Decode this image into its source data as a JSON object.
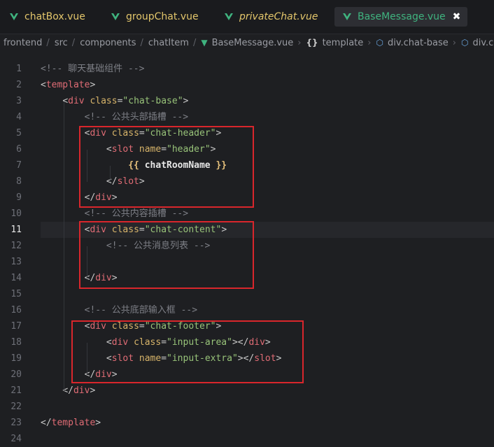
{
  "tabs": [
    {
      "label": "chatBox.vue",
      "icon": "vue-icon",
      "active": false,
      "italic": false
    },
    {
      "label": "groupChat.vue",
      "icon": "vue-icon",
      "active": false,
      "italic": false
    },
    {
      "label": "privateChat.vue",
      "icon": "vue-icon",
      "active": false,
      "italic": true
    },
    {
      "label": "BaseMessage.vue",
      "icon": "vue-icon",
      "active": true,
      "italic": false,
      "close": "✖"
    }
  ],
  "breadcrumb": [
    {
      "label": "frontend"
    },
    {
      "label": "src"
    },
    {
      "label": "components"
    },
    {
      "label": "chatItem"
    },
    {
      "label": "BaseMessage.vue",
      "icon": "vue-icon"
    },
    {
      "label": "template",
      "icon": "braces-icon"
    },
    {
      "label": "div.chat-base",
      "icon": "cube-icon"
    },
    {
      "label": "div.chat-co",
      "icon": "cube-icon"
    }
  ],
  "editor": {
    "current_line": 11,
    "lines": [
      {
        "n": "1",
        "text": "<!-- 聊天基础组件 -->"
      },
      {
        "n": "2",
        "text": "<template>"
      },
      {
        "n": "3",
        "text": "    <div class=\"chat-base\">"
      },
      {
        "n": "4",
        "text": "        <!-- 公共头部插槽 -->"
      },
      {
        "n": "5",
        "text": "        <div class=\"chat-header\">"
      },
      {
        "n": "6",
        "text": "            <slot name=\"header\">"
      },
      {
        "n": "7",
        "text": "                {{ chatRoomName }}"
      },
      {
        "n": "8",
        "text": "            </slot>"
      },
      {
        "n": "9",
        "text": "        </div>"
      },
      {
        "n": "10",
        "text": "        <!-- 公共内容插槽 -->"
      },
      {
        "n": "11",
        "text": "        <div class=\"chat-content\">"
      },
      {
        "n": "12",
        "text": "            <!-- 公共消息列表 -->"
      },
      {
        "n": "13",
        "text": ""
      },
      {
        "n": "14",
        "text": "        </div>"
      },
      {
        "n": "15",
        "text": ""
      },
      {
        "n": "16",
        "text": "        <!-- 公共底部输入框 -->"
      },
      {
        "n": "17",
        "text": "        <div class=\"chat-footer\">"
      },
      {
        "n": "18",
        "text": "            <div class=\"input-area\"></div>"
      },
      {
        "n": "19",
        "text": "            <slot name=\"input-extra\"></slot>"
      },
      {
        "n": "20",
        "text": "        </div>"
      },
      {
        "n": "21",
        "text": "    </div>"
      },
      {
        "n": "22",
        "text": ""
      },
      {
        "n": "23",
        "text": "</template>"
      },
      {
        "n": "24",
        "text": ""
      }
    ]
  },
  "colors": {
    "tag": "#e06c75",
    "attr": "#d7b46a",
    "string": "#98c379",
    "comment": "#7d7f86",
    "vue_green": "#3fb37f",
    "highlight_box": "#d9262c"
  }
}
